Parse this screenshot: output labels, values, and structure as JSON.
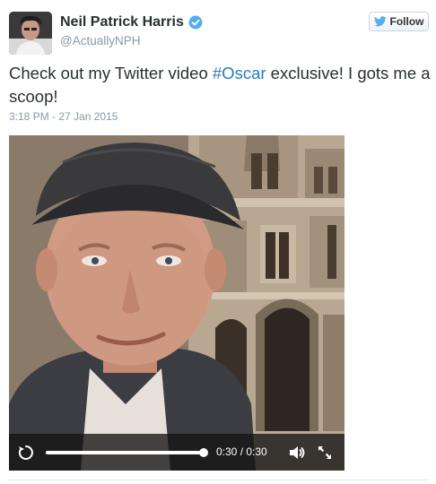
{
  "author": {
    "display_name": "Neil Patrick Harris",
    "screen_name": "@ActuallyNPH",
    "verified_icon": "verified-badge-icon",
    "avatar_icon": "avatar-photo"
  },
  "follow_button": {
    "label": "Follow",
    "icon": "twitter-bird-icon"
  },
  "tweet": {
    "text_before": "Check out my Twitter video ",
    "hashtag": "#Oscar",
    "text_after": " exclusive! I gots me a scoop!",
    "timestamp": "3:18 PM - 27 Jan 2015"
  },
  "video": {
    "time_display": "0:30 / 0:30",
    "progress_fraction": 1.0,
    "icons": {
      "replay": "replay-icon",
      "volume": "volume-icon",
      "fullscreen": "fullscreen-icon"
    }
  },
  "colors": {
    "hashtag": "#2b7bb9",
    "verified": "#55acee",
    "secondary_text": "#8899a6"
  }
}
